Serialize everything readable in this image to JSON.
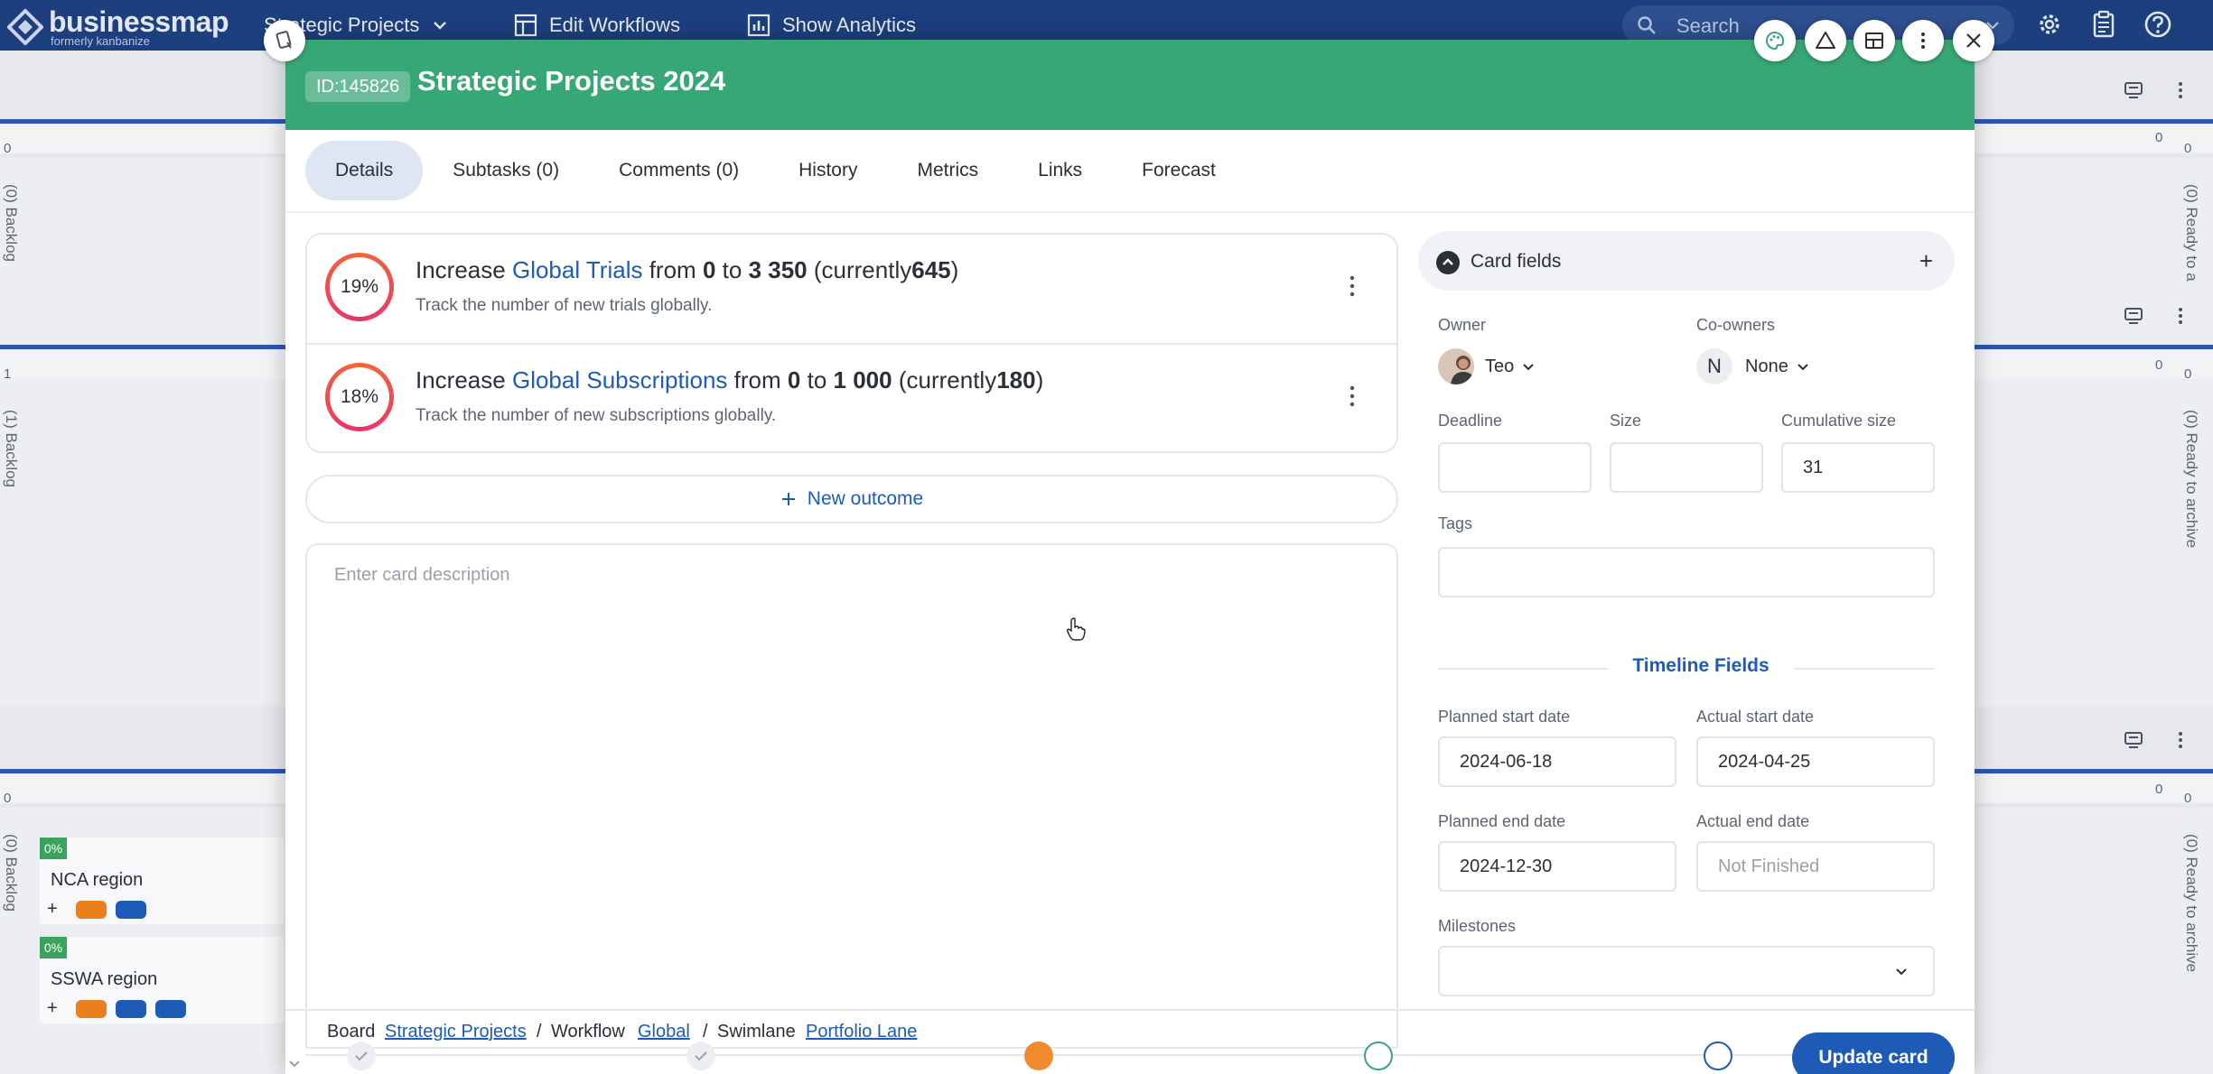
{
  "app": {
    "logo_name": "businessmap",
    "logo_sub": "formerly kanbanize",
    "nav": [
      {
        "label": "Strategic Projects",
        "icon": "chevron-down-icon"
      },
      {
        "label": "Edit Workflows",
        "icon": "workflow-grid-icon"
      },
      {
        "label": "Show Analytics",
        "icon": "analytics-chart-icon"
      }
    ],
    "search_placeholder": "Search",
    "top_icons": [
      "gear-icon",
      "clipboard-icon",
      "help-icon"
    ]
  },
  "board": {
    "lanes": [
      {
        "left_label": "(0) Backlog",
        "left_count": "0",
        "right_label": "(0) Ready to a",
        "right_count": "0",
        "color": "#2d55b4",
        "right_color": "#3aa45c"
      },
      {
        "left_label": "(1) Backlog",
        "left_count": "1",
        "right_label": "(0) Ready to archive",
        "right_count": "0",
        "color": "#2d55b4",
        "right_color": "#7b49c8"
      },
      {
        "left_label": "(0) Backlog",
        "left_count": "0",
        "right_label": "(0) Ready to archive",
        "right_count": "0",
        "color": "#2d55b4",
        "right_color": "#3aa45c"
      }
    ],
    "cards": [
      {
        "pct": "0%",
        "title": "NCA region",
        "plus": "+"
      },
      {
        "pct": "0%",
        "title": "SSWA region",
        "plus": "+"
      }
    ],
    "colors": {
      "chip_orange": "#ea7f1d",
      "chip_blue": "#1e5bb7"
    }
  },
  "modal": {
    "card_id": "ID:145826",
    "title": "Strategic Projects 2024",
    "header_color": "#38a776",
    "tabs": [
      {
        "label": "Details",
        "active": true
      },
      {
        "label": "Subtasks (0)"
      },
      {
        "label": "Comments (0)"
      },
      {
        "label": "History"
      },
      {
        "label": "Metrics"
      },
      {
        "label": "Links"
      },
      {
        "label": "Forecast"
      }
    ],
    "outcomes": [
      {
        "progress": "19%",
        "prefix": "Increase",
        "name": "Global Trials",
        "from_word": "from",
        "from": "0",
        "to_word": "to",
        "to": "3 350",
        "current_open": "(currently",
        "current": "645",
        "current_close": ")",
        "description": "Track the number of new trials globally."
      },
      {
        "progress": "18%",
        "prefix": "Increase",
        "name": "Global Subscriptions",
        "from_word": "from",
        "from": "0",
        "to_word": "to",
        "to": "1 000",
        "current_open": "(currently",
        "current": "180",
        "current_close": ")",
        "description": "Track the number of new subscriptions globally."
      }
    ],
    "new_outcome_label": "New outcome",
    "description_placeholder": "Enter card description",
    "card_fields": {
      "title": "Card fields",
      "plus": "+",
      "owner_label": "Owner",
      "owner_value": "Teo",
      "coowners_label": "Co-owners",
      "coowners_initial": "N",
      "coowners_value": "None",
      "deadline_label": "Deadline",
      "deadline_value": "",
      "size_label": "Size",
      "size_value": "",
      "cumulative_label": "Cumulative size",
      "cumulative_value": "31",
      "tags_label": "Tags",
      "tags_value": "",
      "timeline_title": "Timeline Fields",
      "planned_start_label": "Planned start date",
      "planned_start_value": "2024-06-18",
      "actual_start_label": "Actual start date",
      "actual_start_value": "2024-04-25",
      "planned_end_label": "Planned end date",
      "planned_end_value": "2024-12-30",
      "actual_end_label": "Actual end date",
      "actual_end_placeholder": "Not Finished",
      "milestones_label": "Milestones",
      "milestones_value": ""
    },
    "breadcrumb": {
      "board_label": "Board",
      "board_value": "Strategic Projects",
      "sep": "/",
      "workflow_label": "Workflow",
      "workflow_value": "Global",
      "swimlane_label": "Swimlane",
      "swimlane_value": "Portfolio Lane"
    },
    "steps": [
      "done",
      "done",
      "current",
      "next-green",
      "next-blue"
    ],
    "update_button": "Update card",
    "action_icons": [
      "palette-icon",
      "warning-triangle-icon",
      "layout-icon",
      "kebab-menu-icon",
      "close-icon"
    ]
  }
}
